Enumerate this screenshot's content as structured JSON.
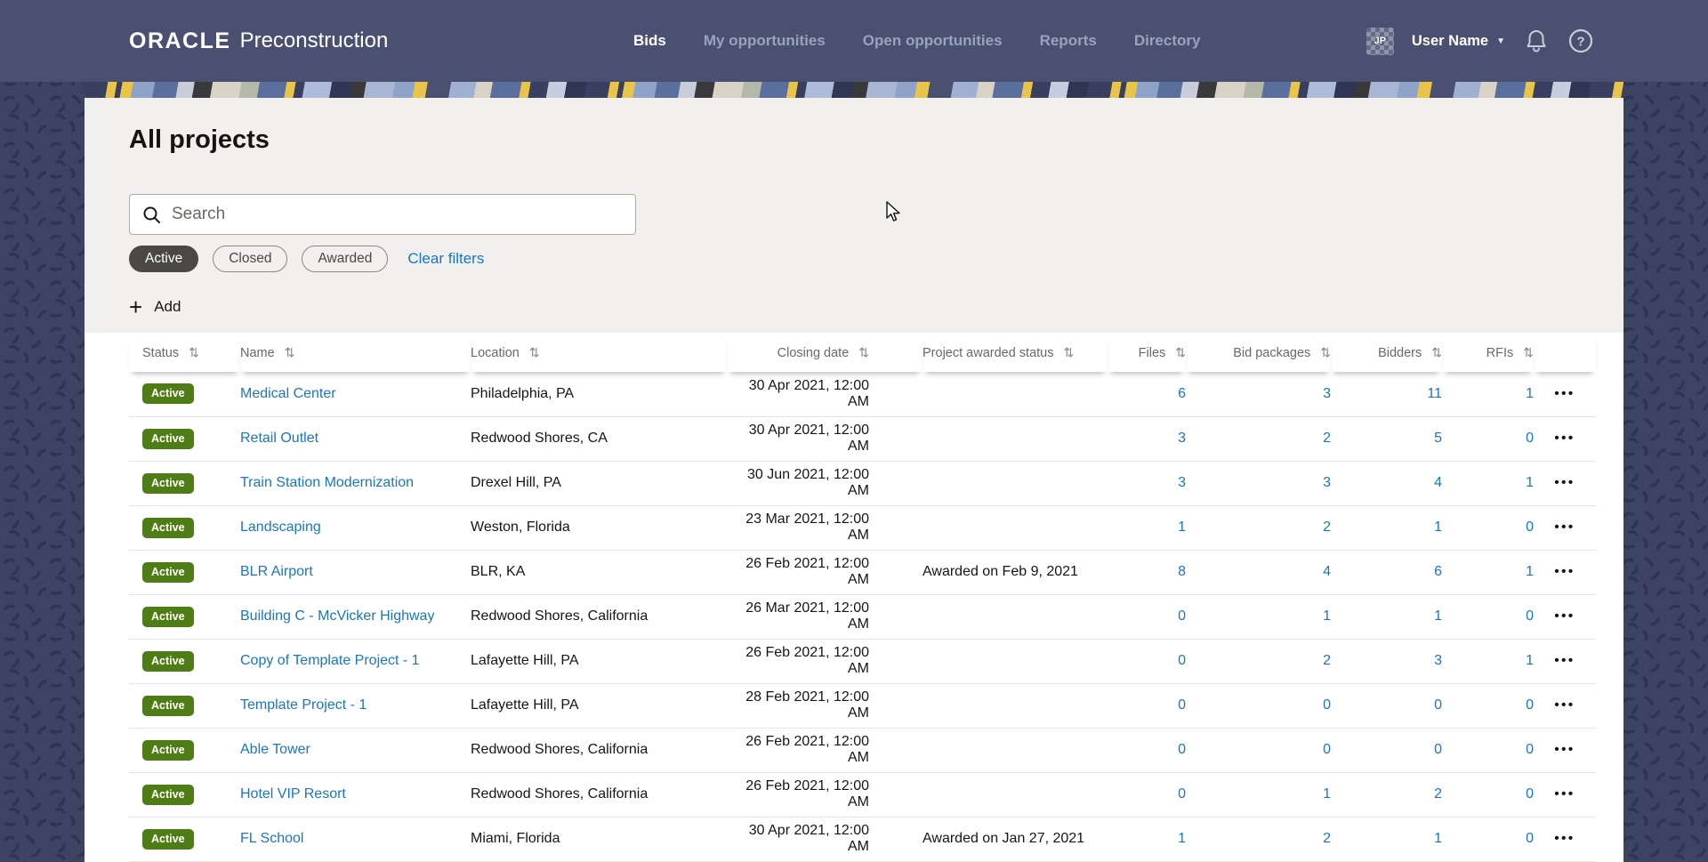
{
  "header": {
    "brand": {
      "logo": "ORACLE",
      "product": "Preconstruction"
    },
    "nav": [
      {
        "label": "Bids",
        "active": true
      },
      {
        "label": "My opportunities",
        "active": false
      },
      {
        "label": "Open opportunities",
        "active": false
      },
      {
        "label": "Reports",
        "active": false
      },
      {
        "label": "Directory",
        "active": false
      }
    ],
    "user": {
      "avatar_initials": "JP",
      "name": "User Name"
    }
  },
  "page": {
    "title": "All projects",
    "search_placeholder": "Search",
    "search_value": "",
    "chips": [
      {
        "label": "Active",
        "selected": true
      },
      {
        "label": "Closed",
        "selected": false
      },
      {
        "label": "Awarded",
        "selected": false
      }
    ],
    "clear_filters_label": "Clear filters",
    "add_label": "Add"
  },
  "icons": {
    "sort": "⇅",
    "row_menu": "•••",
    "add_plus": "+",
    "caret_down": "▼"
  },
  "table": {
    "columns": [
      "Status",
      "Name",
      "Location",
      "Closing date",
      "Project awarded status",
      "Files",
      "Bid packages",
      "Bidders",
      "RFIs"
    ],
    "rows": [
      {
        "status": "Active",
        "name": "Medical Center",
        "location": "Philadelphia, PA",
        "closing": "30 Apr 2021, 12:00 AM",
        "awarded": "",
        "files": "6",
        "bid_packages": "3",
        "bidders": "11",
        "rfis": "1"
      },
      {
        "status": "Active",
        "name": "Retail Outlet",
        "location": "Redwood Shores, CA",
        "closing": "30 Apr 2021, 12:00 AM",
        "awarded": "",
        "files": "3",
        "bid_packages": "2",
        "bidders": "5",
        "rfis": "0"
      },
      {
        "status": "Active",
        "name": "Train Station Modernization",
        "location": "Drexel Hill, PA",
        "closing": "30 Jun 2021, 12:00 AM",
        "awarded": "",
        "files": "3",
        "bid_packages": "3",
        "bidders": "4",
        "rfis": "1"
      },
      {
        "status": "Active",
        "name": "Landscaping",
        "location": "Weston, Florida",
        "closing": "23 Mar 2021, 12:00 AM",
        "awarded": "",
        "files": "1",
        "bid_packages": "2",
        "bidders": "1",
        "rfis": "0"
      },
      {
        "status": "Active",
        "name": "BLR Airport",
        "location": "BLR, KA",
        "closing": "26 Feb 2021, 12:00 AM",
        "awarded": "Awarded on Feb 9, 2021",
        "files": "8",
        "bid_packages": "4",
        "bidders": "6",
        "rfis": "1"
      },
      {
        "status": "Active",
        "name": "Building C - McVicker Highway",
        "location": "Redwood Shores, California",
        "closing": "26 Mar 2021, 12:00 AM",
        "awarded": "",
        "files": "0",
        "bid_packages": "1",
        "bidders": "1",
        "rfis": "0"
      },
      {
        "status": "Active",
        "name": "Copy of Template Project - 1",
        "location": "Lafayette Hill, PA",
        "closing": "26 Feb 2021, 12:00 AM",
        "awarded": "",
        "files": "0",
        "bid_packages": "2",
        "bidders": "3",
        "rfis": "1"
      },
      {
        "status": "Active",
        "name": "Template Project - 1",
        "location": "Lafayette Hill, PA",
        "closing": "28 Feb 2021, 12:00 AM",
        "awarded": "",
        "files": "0",
        "bid_packages": "0",
        "bidders": "0",
        "rfis": "0"
      },
      {
        "status": "Active",
        "name": "Able Tower",
        "location": "Redwood Shores, California",
        "closing": "26 Feb 2021, 12:00 AM",
        "awarded": "",
        "files": "0",
        "bid_packages": "0",
        "bidders": "0",
        "rfis": "0"
      },
      {
        "status": "Active",
        "name": "Hotel VIP Resort",
        "location": "Redwood Shores, California",
        "closing": "26 Feb 2021, 12:00 AM",
        "awarded": "",
        "files": "0",
        "bid_packages": "1",
        "bidders": "2",
        "rfis": "0"
      },
      {
        "status": "Active",
        "name": "FL School",
        "location": "Miami, Florida",
        "closing": "30 Apr 2021, 12:00 AM",
        "awarded": "Awarded on Jan 27, 2021",
        "files": "1",
        "bid_packages": "2",
        "bidders": "1",
        "rfis": "0"
      }
    ]
  },
  "colors": {
    "topbar_bg": "#4a5070",
    "background_pattern": "#3d4363",
    "card_bg": "#f1f0ef",
    "active_badge_green": "#4f7d15",
    "link_blue": "#1a76c2",
    "selected_chip_bg": "#4a4846",
    "stripe_yellow": "#e8c44a",
    "text_dark": "#161513",
    "text_muted": "#6b6862"
  }
}
